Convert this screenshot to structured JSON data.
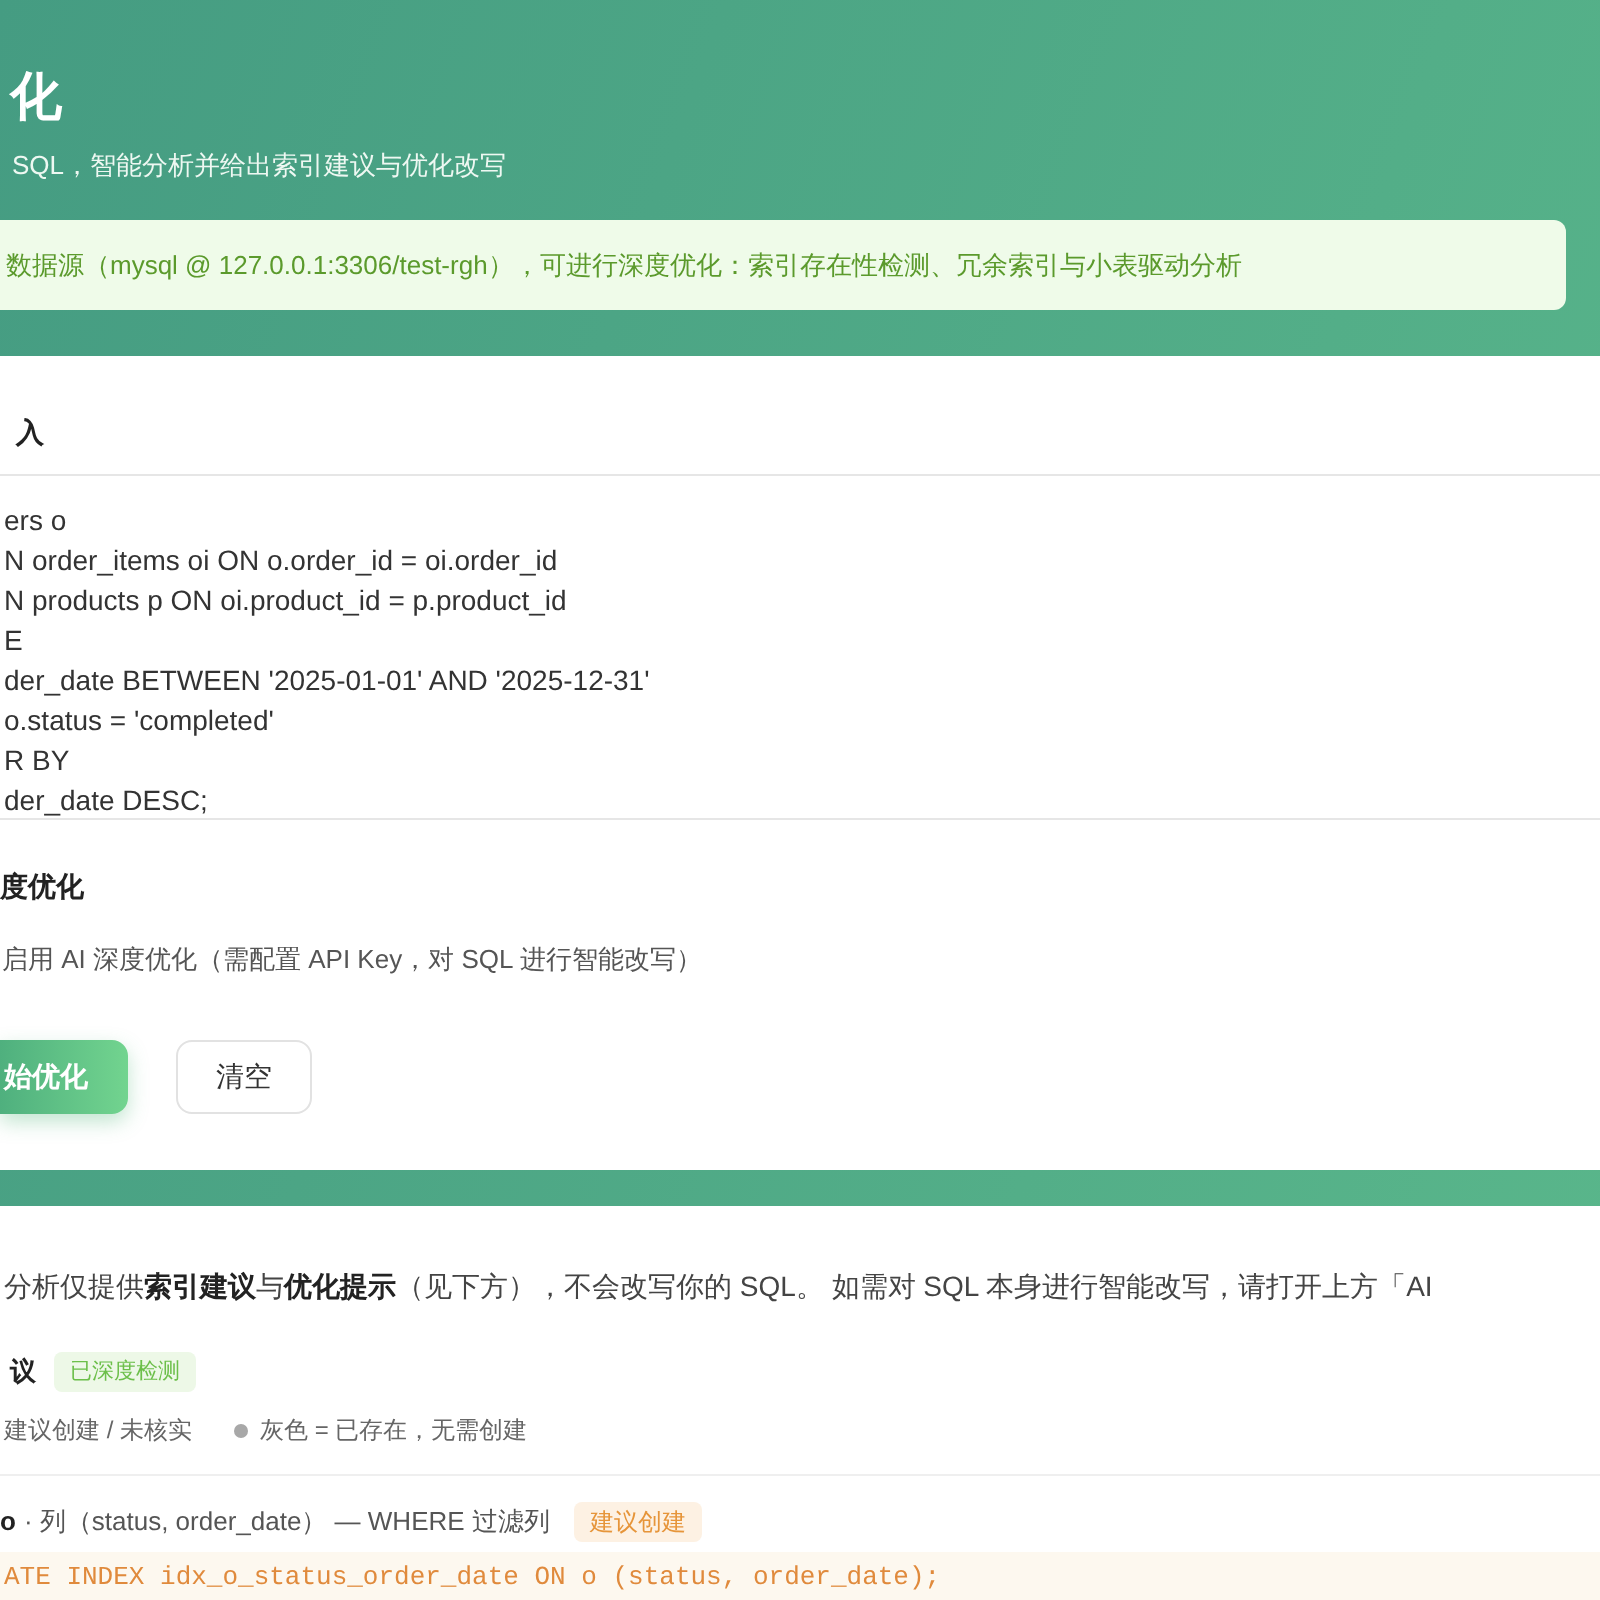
{
  "header": {
    "title": "化",
    "subtitle": "SQL，智能分析并给出索引建议与优化改写",
    "notice": "数据源（mysql @ 127.0.0.1:3306/test-rgh），可进行深度优化：索引存在性检测、冗余索引与小表驱动分析"
  },
  "input_card": {
    "label": "入",
    "sql": {
      "value": "ers o\nN order_items oi ON o.order_id = oi.order_id\nN products p ON oi.product_id = p.product_id\nE\nder_date BETWEEN '2025-01-01' AND '2025-12-31'\no.status = 'completed'\nR BY\nder_date DESC;"
    },
    "ai_section": {
      "title": "度优化",
      "option": "启用 AI 深度优化（需配置 API Key，对 SQL 进行智能改写）"
    },
    "buttons": [
      {
        "label": "始优化",
        "kind": "primary"
      },
      {
        "label": "清空",
        "kind": "secondary"
      }
    ]
  },
  "result_card": {
    "note": "分析仅提供**索引建议**与**优化提示**（见下方），不会改写你的 SQL。 如需对 SQL 本身进行智能改写，请打开上方「AI",
    "index_section": {
      "title": "议",
      "badge": "已深度检测",
      "legend": [
        {
          "label": "建议创建 / 未核实"
        },
        {
          "label": "灰色 = 已存在，无需创建",
          "color": "#a8a8a8"
        }
      ],
      "suggestions": [
        {
          "table": "o",
          "detail": "· 列（status, order_date） — WHERE 过滤列",
          "status": "建议创建",
          "sql": "ATE INDEX idx_o_status_order_date ON o (status, order_date);"
        }
      ]
    }
  }
}
